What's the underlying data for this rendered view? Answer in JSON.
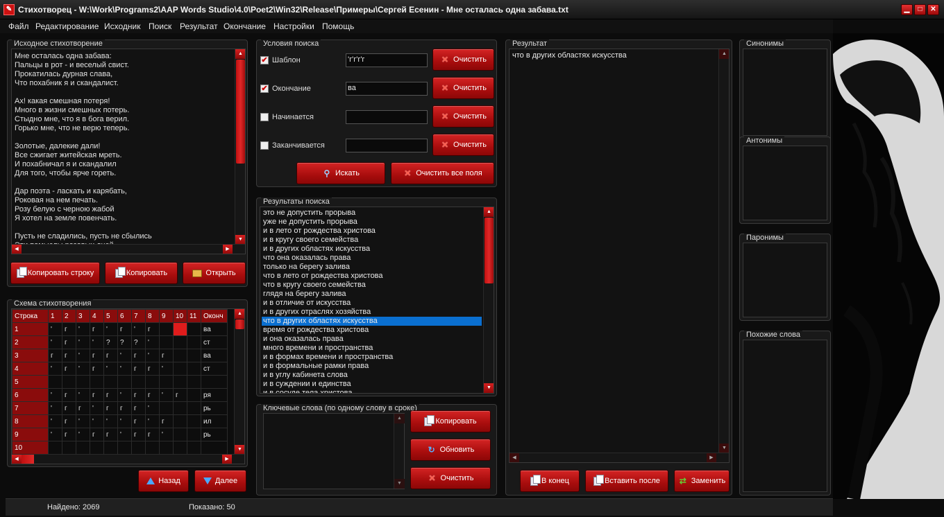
{
  "window": {
    "title": "Стихотворец - W:\\Work\\Programs2\\AAP Words Studio\\4.0\\Poet2\\Win32\\Release\\Примеры\\Сергей Есенин - Мне осталась одна забава.txt",
    "minimize": "▁",
    "maximize": "□",
    "close": "✕"
  },
  "menu": [
    "Файл",
    "Редактирование",
    "Исходник",
    "Поиск",
    "Результат",
    "Окончание",
    "Настройки",
    "Помощь"
  ],
  "source": {
    "title": "Исходное стихотворение",
    "lines": [
      "Мне осталась одна забава:",
      "Пальцы в рот - и веселый свист.",
      "Прокатилась дурная слава,",
      "Что похабник я и скандалист.",
      "",
      "Ах! какая смешная потеря!",
      "Много в жизни смешных потерь.",
      "Стыдно мне, что я в бога верил.",
      "Горько мне, что не верю теперь.",
      "",
      "Золотые, далекие дали!",
      "Все сжигает житейская мреть.",
      "И похабничал я и скандалил",
      "Для того, чтобы ярче гореть.",
      "",
      "Дар поэта - ласкать и карябать,",
      "Роковая на нем печать.",
      "Розу белую с черною жабой",
      "Я хотел на земле повенчать.",
      "",
      "Пусть не сладились, пусть не сбылись",
      "Эти помыслы розовых дней."
    ],
    "buttons": {
      "copy_line": "Копировать строку",
      "copy": "Копировать",
      "open": "Открыть"
    }
  },
  "scheme": {
    "title": "Схема стихотворения",
    "headers": [
      "Строка",
      "1",
      "2",
      "3",
      "4",
      "5",
      "6",
      "7",
      "8",
      "9",
      "10",
      "11",
      "Оконч"
    ],
    "rows": [
      [
        "1",
        "'",
        "г",
        "'",
        "г",
        "'",
        "г",
        "'",
        "г",
        "",
        "",
        "ва"
      ],
      [
        "2",
        "'",
        "г",
        "'",
        "'",
        "?",
        "?",
        "?",
        "'",
        "",
        "",
        "ст"
      ],
      [
        "3",
        "г",
        "г",
        "'",
        "г",
        "г",
        "'",
        "г",
        "'",
        "г",
        "",
        "ва"
      ],
      [
        "4",
        "'",
        "г",
        "'",
        "г",
        "'",
        "'",
        "г",
        "г",
        "'",
        "",
        "ст"
      ],
      [
        "5",
        "",
        "",
        "",
        "",
        "",
        "",
        "",
        "",
        "",
        "",
        ""
      ],
      [
        "6",
        "'",
        "г",
        "'",
        "г",
        "г",
        "'",
        "г",
        "г",
        "'",
        "г",
        "ря"
      ],
      [
        "7",
        "'",
        "г",
        "г",
        "'",
        "г",
        "г",
        "г",
        "'",
        "",
        "",
        "рь"
      ],
      [
        "8",
        "'",
        "г",
        "'",
        "'",
        "'",
        "'",
        "г",
        "'",
        "г",
        "",
        "ил"
      ],
      [
        "9",
        "'",
        "г",
        "'",
        "г",
        "г",
        "'",
        "г",
        "г",
        "'",
        "",
        "рь"
      ],
      [
        "10",
        "",
        "",
        "",
        "",
        "",
        "",
        "",
        "",
        "",
        "",
        ""
      ]
    ],
    "buttons": {
      "back": "Назад",
      "next": "Далее"
    }
  },
  "conditions": {
    "title": "Условия поиска",
    "items": [
      {
        "label": "Шаблон",
        "checked": "✔",
        "value": "'г'г'г'г"
      },
      {
        "label": "Окончание",
        "checked": "✔",
        "value": "ва"
      },
      {
        "label": "Начинается",
        "checked": "",
        "value": ""
      },
      {
        "label": "Заканчивается",
        "checked": "",
        "value": ""
      }
    ],
    "clear_label": "Очистить",
    "search_label": "Искать",
    "clear_all_label": "Очистить все поля"
  },
  "search_results": {
    "title": "Результаты поиска",
    "items": [
      "это не допустить прорыва",
      "уже не допустить прорыва",
      "и в лето от рождества христова",
      "и в кругу своего семейства",
      "и в других областях искусства",
      "что она оказалась права",
      "только на берегу залива",
      "что в лето от рождества христова",
      "что в кругу своего семейства",
      "глядя на берегу залива",
      "и в отличие от искусства",
      "и в других отраслях хозяйства",
      "что в других областях искусства",
      "время от рождества христова",
      "и она оказалась права",
      "много времени и пространства",
      "и в формах времени и пространства",
      "и в формальные рамки права",
      "и в углу кабинета слова",
      "и в суждении и единства",
      "и в сосуде тела христова"
    ],
    "selected_index": "12"
  },
  "keywords": {
    "title": "Ключевые слова (по одному слову в сроке)",
    "copy": "Копировать",
    "refresh": "Обновить",
    "clear": "Очистить"
  },
  "result": {
    "title": "Результат",
    "text": "что в других областях искусства",
    "buttons": {
      "to_end": "В конец",
      "insert_after": "Вставить после",
      "replace": "Заменить"
    }
  },
  "side_panels": {
    "synonyms": "Синонимы",
    "antonyms": "Антонимы",
    "paronyms": "Паронимы",
    "similar": "Похожие слова"
  },
  "status": {
    "found": "Найдено: 2069",
    "shown": "Показано: 50"
  },
  "colors": {
    "accent": "#c41414",
    "selection": "#0a6fd0"
  }
}
